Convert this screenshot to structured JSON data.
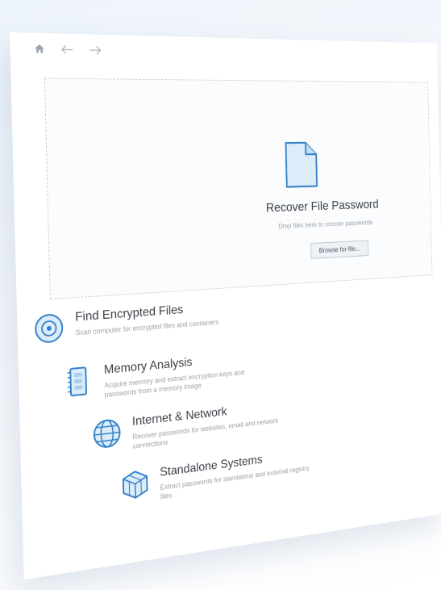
{
  "nav": {
    "home_icon": "home-icon",
    "back_icon": "arrow-left-icon",
    "forward_icon": "arrow-right-icon"
  },
  "drop_zone": {
    "icon": "document-icon",
    "title": "Recover File Password",
    "subtitle": "Drop files here to recover passwords",
    "browse_label": "Browse for file..."
  },
  "features": [
    {
      "icon": "disc-icon",
      "title": "Find Encrypted Files",
      "description": "Scan computer for encrypted files and containers"
    },
    {
      "icon": "memory-chip-icon",
      "title": "Memory Analysis",
      "description": "Acquire memory and extract encryption keys and passwords from a memory image"
    },
    {
      "icon": "globe-icon",
      "title": "Internet & Network",
      "description": "Recover passwords for websites, email and network connections"
    },
    {
      "icon": "cubes-icon",
      "title": "Standalone Systems",
      "description": "Extract passwords for standalone and external registry files"
    }
  ],
  "colors": {
    "accent": "#2f7fc8",
    "icon_fill": "#dcecf9",
    "text_primary": "#3a3f45",
    "text_secondary": "#9aa1a8"
  }
}
